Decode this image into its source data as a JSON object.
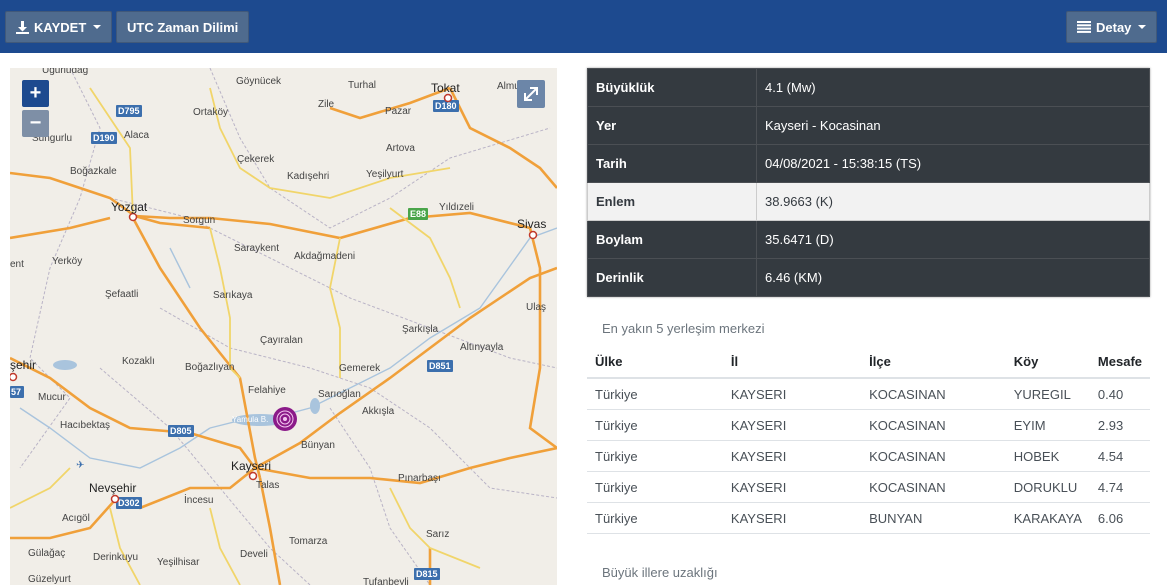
{
  "toolbar": {
    "save_label": "KAYDET",
    "utc_label": "UTC Zaman Dilimi",
    "detail_label": "Detay"
  },
  "map": {
    "zoom_in": "+",
    "zoom_out": "−",
    "places": {
      "ugurludag": "Uğurludağ",
      "goynucek": "Göynücek",
      "turhal": "Turhal",
      "tokat": "Tokat",
      "almus": "Almus",
      "ortakoy": "Ortaköy",
      "zile": "Zile",
      "pazar": "Pazar",
      "sungurlu": "Sungurlu",
      "alaca": "Alaca",
      "artova": "Artova",
      "cekerek": "Çekerek",
      "bogazkale": "Boğazkale",
      "kadisehri": "Kadışehri",
      "yesilyurt": "Yeşilyurt",
      "yozgat": "Yozgat",
      "sorgun": "Sorgun",
      "yildizeli": "Yıldızeli",
      "sivas": "Sivas",
      "saraykent": "Saraykent",
      "akdagmadeni": "Akdağmadeni",
      "ent": "ent",
      "yerkoy": "Yerköy",
      "sefaatli": "Şefaatli",
      "sarikaya": "Sarıkaya",
      "ulas": "Ulaş",
      "sarkisla": "Şarkışla",
      "cayiralan": "Çayıralan",
      "altinyayla": "Altınyayla",
      "sehir": "şehir",
      "kozakli": "Kozaklı",
      "bogazliyan": "Boğazlıyan",
      "gemerek": "Gemerek",
      "mucur": "Mucur",
      "felahiye": "Felahiye",
      "sarioglan": "Sarıoğlan",
      "akkisla": "Akkışla",
      "hacibektas": "Hacıbektaş",
      "yamula": "Yamula B.",
      "bunyan": "Bünyan",
      "kayseri": "Kayseri",
      "pinarbasi": "Pınarbaşı",
      "nevsehir": "Nevşehir",
      "talas": "Talas",
      "incesu": "İncesu",
      "acigol": "Acıgöl",
      "tomarza": "Tomarza",
      "sariz": "Sarız",
      "gulagac": "Gülağaç",
      "derinkuyu": "Derinkuyu",
      "yesilhisar": "Yeşilhisar",
      "develi": "Develi",
      "guzelyurt": "Güzelyurt",
      "tufanbeyli": "Tufanbeyli"
    },
    "shields": {
      "d795": "D795",
      "d180": "D180",
      "d190": "D190",
      "e88": "E88",
      "d851": "D851",
      "d805": "D805",
      "d302": "D302",
      "d815": "D815",
      "s57": "57"
    },
    "epicenter_color": "#8b1a89"
  },
  "details": [
    {
      "key": "Büyüklük",
      "value": "4.1 (Mw)"
    },
    {
      "key": "Yer",
      "value": "Kayseri - Kocasinan"
    },
    {
      "key": "Tarih",
      "value": "04/08/2021 - 15:38:15 (TS)"
    },
    {
      "key": "Enlem",
      "value": "38.9663 (K)"
    },
    {
      "key": "Boylam",
      "value": "35.6471 (D)"
    },
    {
      "key": "Derinlik",
      "value": "6.46 (KM)"
    }
  ],
  "nearest": {
    "title": "En yakın 5 yerleşim merkezi",
    "headers": {
      "country": "Ülke",
      "province": "İl",
      "district": "İlçe",
      "village": "Köy",
      "distance": "Mesafe"
    },
    "rows": [
      {
        "country": "Türkiye",
        "province": "KAYSERI",
        "district": "KOCASINAN",
        "village": "YUREGIL",
        "distance": "0.40"
      },
      {
        "country": "Türkiye",
        "province": "KAYSERI",
        "district": "KOCASINAN",
        "village": "EYIM",
        "distance": "2.93"
      },
      {
        "country": "Türkiye",
        "province": "KAYSERI",
        "district": "KOCASINAN",
        "village": "HOBEK",
        "distance": "4.54"
      },
      {
        "country": "Türkiye",
        "province": "KAYSERI",
        "district": "KOCASINAN",
        "village": "DORUKLU",
        "distance": "4.74"
      },
      {
        "country": "Türkiye",
        "province": "KAYSERI",
        "district": "BUNYAN",
        "village": "KARAKAYA",
        "distance": "6.06"
      }
    ]
  },
  "big_cities_title": "Büyük illere uzaklığı"
}
